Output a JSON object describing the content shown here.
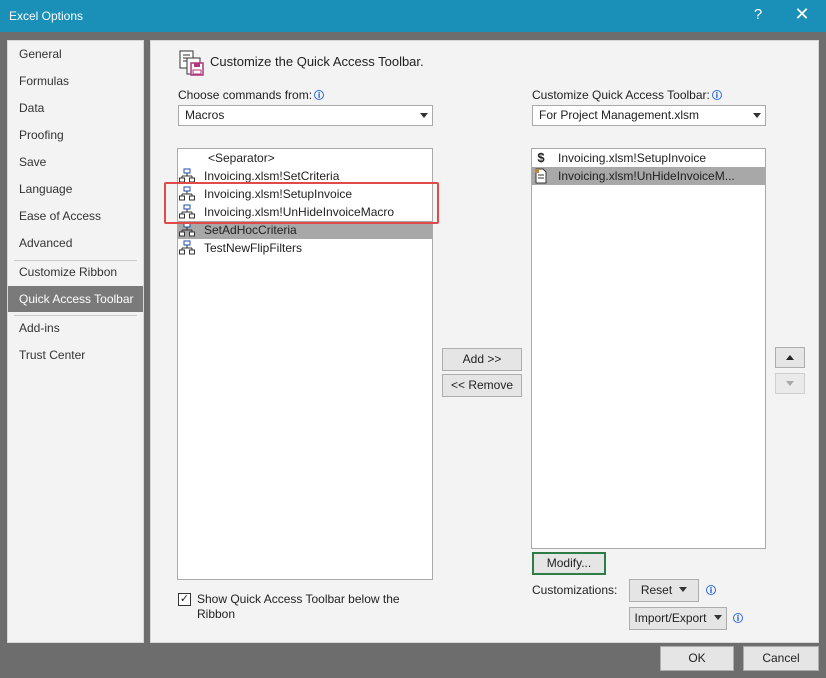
{
  "window": {
    "title": "Excel Options",
    "help_glyph": "?",
    "close_glyph": "✕"
  },
  "sidebar": {
    "items": [
      {
        "label": "General"
      },
      {
        "label": "Formulas"
      },
      {
        "label": "Data"
      },
      {
        "label": "Proofing"
      },
      {
        "label": "Save"
      },
      {
        "label": "Language"
      },
      {
        "label": "Ease of Access"
      },
      {
        "label": "Advanced"
      },
      {
        "label": "Customize Ribbon"
      },
      {
        "label": "Quick Access Toolbar",
        "selected": true
      },
      {
        "label": "Add-ins"
      },
      {
        "label": "Trust Center"
      }
    ]
  },
  "main": {
    "header": "Customize the Quick Access Toolbar.",
    "choose_label": "Choose commands from:",
    "choose_value": "Macros",
    "customize_label": "Customize Quick Access Toolbar:",
    "customize_value": "For Project Management.xlsm",
    "left_list": [
      {
        "label": "<Separator>",
        "icon": "none"
      },
      {
        "label": "Invoicing.xlsm!SetCriteria",
        "icon": "macro-flowchart-icon"
      },
      {
        "label": "Invoicing.xlsm!SetupInvoice",
        "icon": "macro-flowchart-icon"
      },
      {
        "label": "Invoicing.xlsm!UnHideInvoiceMacro",
        "icon": "macro-flowchart-icon"
      },
      {
        "label": "SetAdHocCriteria",
        "icon": "macro-flowchart-icon",
        "selected": true
      },
      {
        "label": "TestNewFlipFilters",
        "icon": "macro-flowchart-icon"
      }
    ],
    "right_list": [
      {
        "label": "Invoicing.xlsm!SetupInvoice",
        "icon": "dollar-sign-icon"
      },
      {
        "label": "Invoicing.xlsm!UnHideInvoiceM...",
        "icon": "document-icon",
        "selected": true
      }
    ],
    "add_button": "Add >>",
    "remove_button": "<< Remove",
    "modify_button": "Modify...",
    "customizations_label": "Customizations:",
    "reset_button": "Reset",
    "import_export_button": "Import/Export",
    "show_below_label": "Show Quick Access Toolbar below the Ribbon",
    "show_below_checked": true
  },
  "footer": {
    "ok": "OK",
    "cancel": "Cancel"
  },
  "colors": {
    "titlebar": "#1a8fb8",
    "highlight": "#e04a4a",
    "selected_item": "#7a7a7a",
    "focus_border": "#2e7d46"
  }
}
